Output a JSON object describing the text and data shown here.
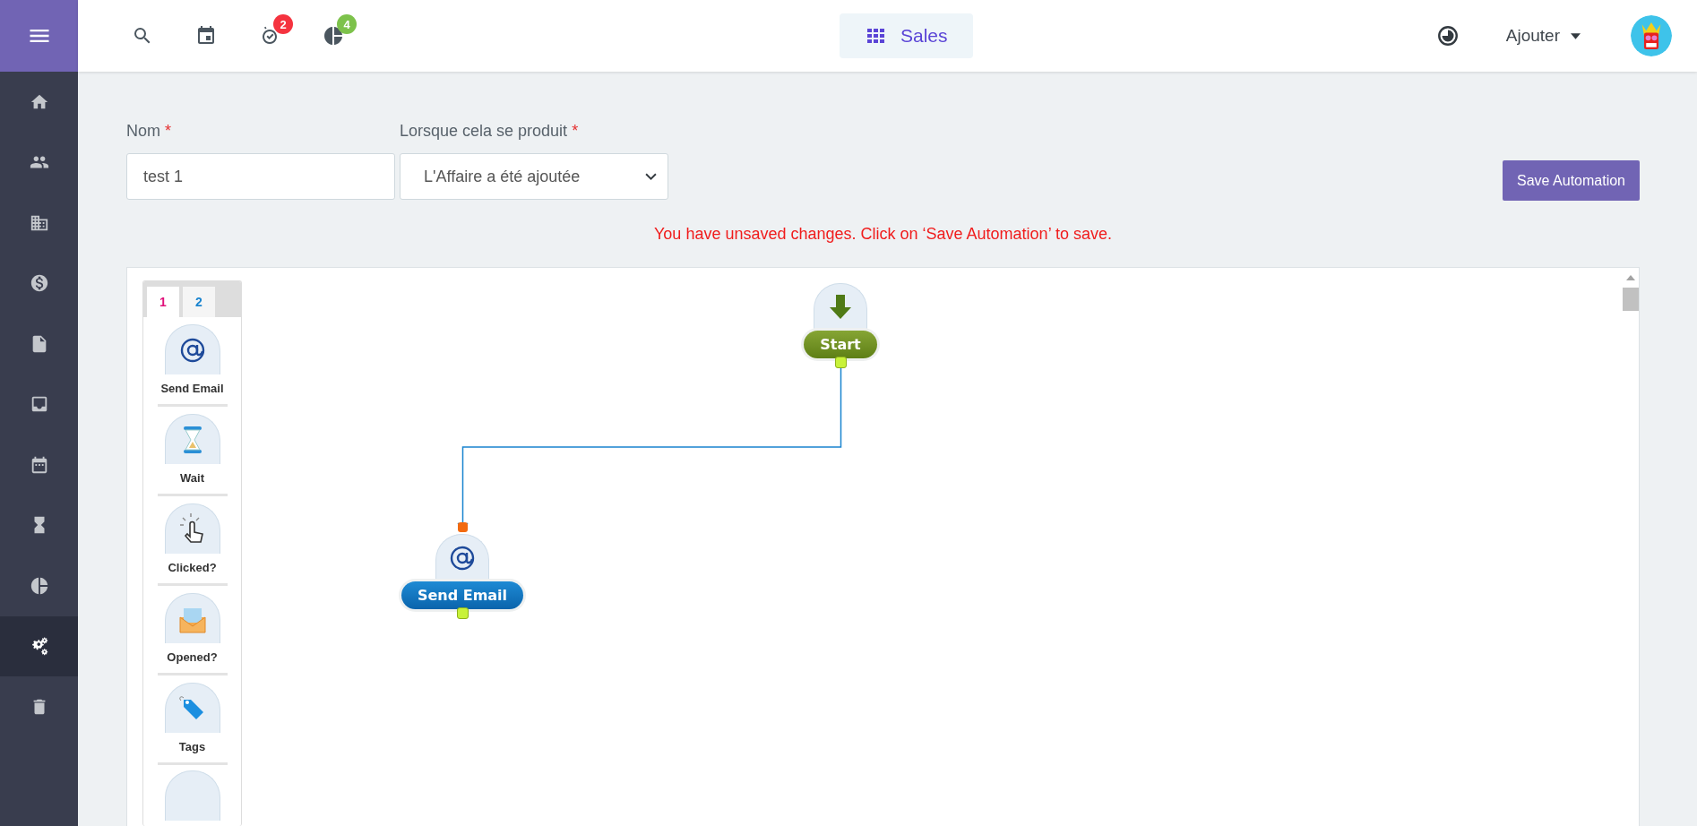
{
  "sidebar": {
    "items": [
      {
        "kind": "home",
        "selected": false
      },
      {
        "kind": "people",
        "selected": false
      },
      {
        "kind": "building",
        "selected": false
      },
      {
        "kind": "dollar",
        "selected": false
      },
      {
        "kind": "document",
        "selected": false
      },
      {
        "kind": "inbox",
        "selected": false
      },
      {
        "kind": "calendar",
        "selected": false
      },
      {
        "kind": "hourglass",
        "selected": false
      },
      {
        "kind": "pie",
        "selected": false
      },
      {
        "kind": "gears",
        "selected": true
      },
      {
        "kind": "trash",
        "selected": false
      }
    ]
  },
  "topbar": {
    "icons": [
      {
        "kind": "search"
      },
      {
        "kind": "event"
      },
      {
        "kind": "timer",
        "badge": "2",
        "color": "#f5333f"
      },
      {
        "kind": "pie",
        "badge": "4",
        "color": "#7dc24b"
      }
    ],
    "app_switcher": "Sales",
    "add_menu": "Ajouter"
  },
  "form": {
    "name_label": "Nom",
    "name_value": "test 1",
    "trigger_label": "Lorsque cela se produit",
    "trigger_value": "L'Affaire a été ajoutée",
    "required_mark": "*",
    "save_button": "Save Automation",
    "warning": "You have unsaved changes. Click on ‘Save Automation’ to save."
  },
  "palette": {
    "tabs": [
      {
        "label": "1",
        "selected": true
      },
      {
        "label": "2",
        "selected": false
      }
    ],
    "items": [
      {
        "kind": "email",
        "label": "Send Email"
      },
      {
        "kind": "wait",
        "label": "Wait"
      },
      {
        "kind": "click",
        "label": "Clicked?"
      },
      {
        "kind": "opened",
        "label": "Opened?"
      },
      {
        "kind": "tags",
        "label": "Tags"
      }
    ]
  },
  "canvas": {
    "nodes": [
      {
        "kind": "start",
        "label": "Start"
      },
      {
        "kind": "email",
        "label": "Send Email"
      }
    ]
  }
}
